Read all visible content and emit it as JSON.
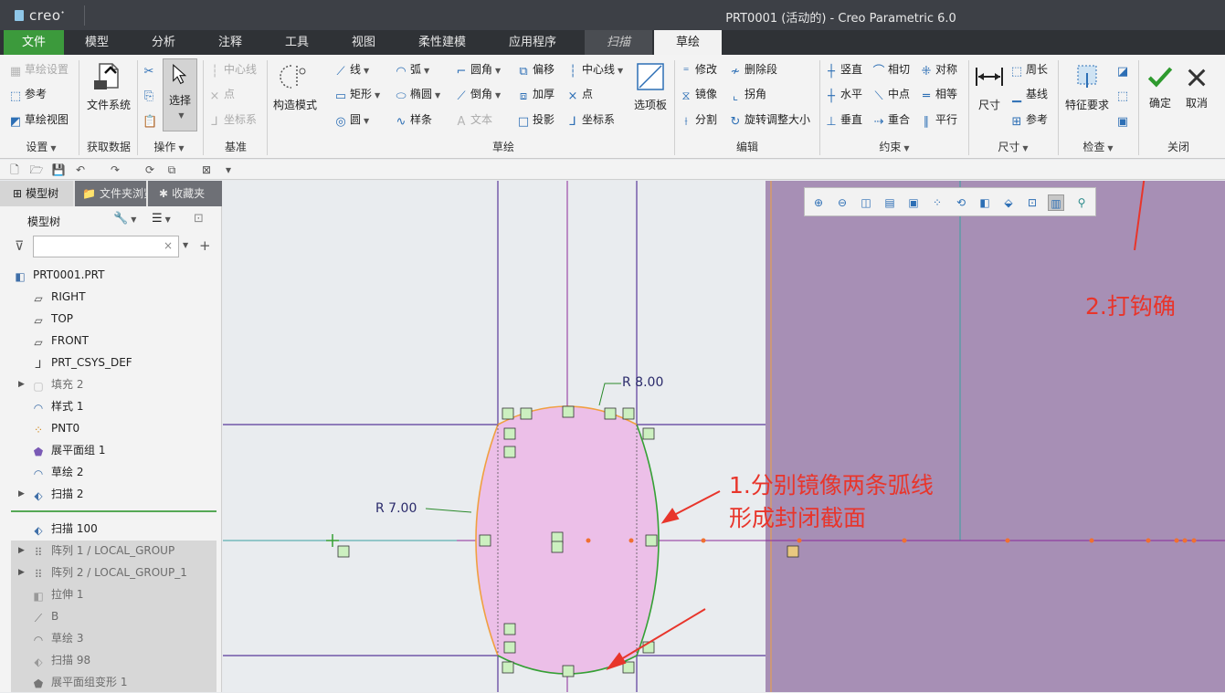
{
  "window": {
    "app": "creo",
    "title": "PRT0001 (活动的) - Creo Parametric 6.0"
  },
  "tabs": [
    {
      "label": "文件"
    },
    {
      "label": "模型"
    },
    {
      "label": "分析"
    },
    {
      "label": "注释"
    },
    {
      "label": "工具"
    },
    {
      "label": "视图"
    },
    {
      "label": "柔性建模"
    },
    {
      "label": "应用程序"
    },
    {
      "label": "扫描"
    },
    {
      "label": "草绘"
    }
  ],
  "ribbon": {
    "setup": {
      "items": [
        "草绘设置",
        "参考",
        "草绘视图"
      ],
      "label": "设置"
    },
    "getdata": {
      "filesystem": "文件系统",
      "label": "获取数据"
    },
    "ops": {
      "select": "选择",
      "label": "操作"
    },
    "datum": {
      "items": [
        "中心线",
        "点",
        "坐标系"
      ],
      "label": "基准"
    },
    "construct": "构造模式",
    "sketch": {
      "col1": [
        "线",
        "矩形",
        "圆"
      ],
      "col2": [
        "弧",
        "椭圆",
        "样条"
      ],
      "col3": [
        "圆角",
        "倒角",
        "文本"
      ],
      "col4": [
        "偏移",
        "加厚",
        "投影"
      ],
      "col5": [
        "中心线",
        "点",
        "坐标系"
      ],
      "palette": "选项板",
      "label": "草绘"
    },
    "edit": {
      "col1": [
        "修改",
        "镜像",
        "分割"
      ],
      "col2": [
        "删除段",
        "拐角",
        "旋转调整大小"
      ],
      "label": "编辑"
    },
    "constrain": {
      "col1": [
        "竖直",
        "水平",
        "垂直"
      ],
      "col2": [
        "相切",
        "中点",
        "重合"
      ],
      "col3": [
        "对称",
        "相等",
        "平行"
      ],
      "label": "约束"
    },
    "dimension": {
      "dim": "尺寸",
      "items": [
        "周长",
        "基线",
        "参考"
      ],
      "label": "尺寸"
    },
    "inspect": {
      "req": "特征要求",
      "label": "检查"
    },
    "close": {
      "ok": "确定",
      "cancel": "取消",
      "label": "关闭"
    }
  },
  "panel": {
    "tabs": [
      "模型树",
      "文件夹浏览器",
      "收藏夹"
    ],
    "header": "模型树",
    "tree": [
      {
        "label": "PRT0001.PRT",
        "icon": "part-icon",
        "gray": false
      },
      {
        "label": "RIGHT",
        "icon": "plane-icon",
        "gray": false
      },
      {
        "label": "TOP",
        "icon": "plane-icon",
        "gray": false
      },
      {
        "label": "FRONT",
        "icon": "plane-icon",
        "gray": false
      },
      {
        "label": "PRT_CSYS_DEF",
        "icon": "csys-icon",
        "gray": false
      },
      {
        "label": "填充 2",
        "icon": "fill-icon",
        "gray": true
      },
      {
        "label": "样式 1",
        "icon": "style-icon",
        "gray": false
      },
      {
        "label": "PNT0",
        "icon": "point-icon",
        "gray": false
      },
      {
        "label": "展平面组 1",
        "icon": "flatten-icon",
        "gray": false
      },
      {
        "label": "草绘 2",
        "icon": "sketch-icon",
        "gray": false
      },
      {
        "label": "扫描 2",
        "icon": "sweep-icon",
        "gray": false
      },
      {
        "label": "扫描 100",
        "icon": "sweep-icon",
        "gray": false
      },
      {
        "label": "阵列 1 / LOCAL_GROUP",
        "icon": "pattern-icon",
        "gray": true
      },
      {
        "label": "阵列 2 / LOCAL_GROUP_1",
        "icon": "pattern-icon",
        "gray": true
      },
      {
        "label": "拉伸 1",
        "icon": "extrude-icon",
        "gray": true
      },
      {
        "label": "B",
        "icon": "curve-icon",
        "gray": true
      },
      {
        "label": "草绘 3",
        "icon": "sketch-icon",
        "gray": true
      },
      {
        "label": "扫描 98",
        "icon": "sweep-icon",
        "gray": true
      },
      {
        "label": "展平面组变形 1",
        "icon": "flatten-icon",
        "gray": true
      }
    ]
  },
  "canvas": {
    "dim_r1": "R 8.00",
    "dim_r2": "R 7.00",
    "note1_line1": "1.分别镜像两条弧线",
    "note1_line2": "形成封闭截面",
    "note2": "2.打钩确",
    "colors": {
      "region": "#ecbfe8",
      "purple_bg": "#a78fb5",
      "note": "#e8352b"
    }
  }
}
